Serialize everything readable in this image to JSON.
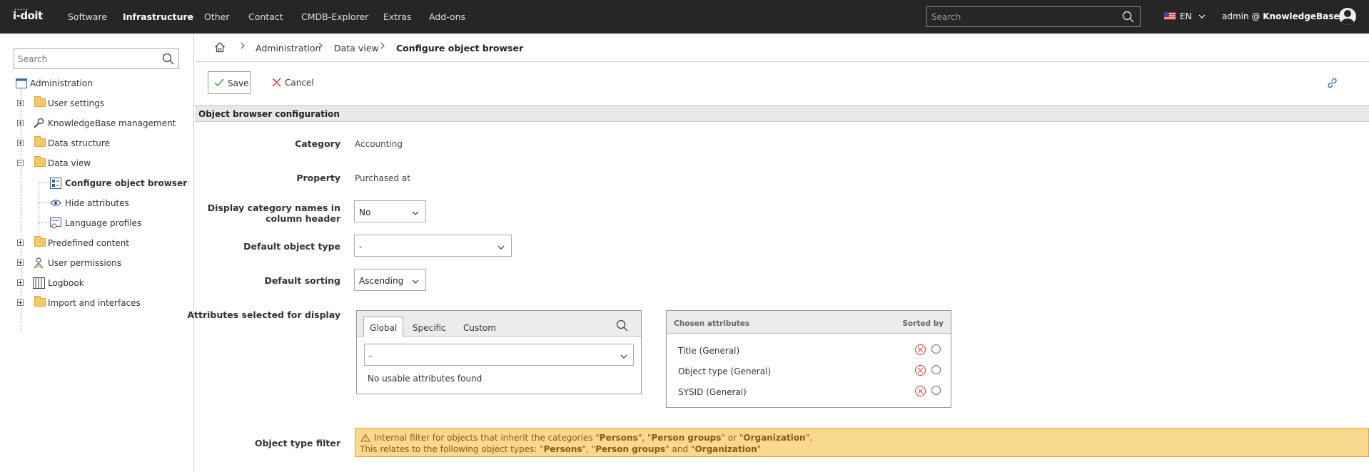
{
  "app": {
    "logo": "i-doit"
  },
  "topnav": {
    "items": [
      "Software",
      "Infrastructure",
      "Other",
      "Contact",
      "CMDB-Explorer",
      "Extras",
      "Add-ons"
    ],
    "active": "Infrastructure",
    "search_placeholder": "Search",
    "language": "EN",
    "user_prefix": "admin @ ",
    "user_tenant": "KnowledgeBase"
  },
  "sidebar": {
    "search_placeholder": "Search",
    "root": "Administration",
    "items": [
      {
        "label": "User settings",
        "icon": "folder-icon"
      },
      {
        "label": "KnowledgeBase management",
        "icon": "wrench-icon"
      },
      {
        "label": "Data structure",
        "icon": "folder-icon"
      },
      {
        "label": "Data view",
        "icon": "folder-icon",
        "expanded": true
      },
      {
        "label": "Configure object browser",
        "icon": "object-browser-icon",
        "selected": true
      },
      {
        "label": "Hide attributes",
        "icon": "eye-icon"
      },
      {
        "label": "Language profiles",
        "icon": "language-profile-icon"
      },
      {
        "label": "Predefined content",
        "icon": "folder-icon"
      },
      {
        "label": "User permissions",
        "icon": "user-permissions-icon"
      },
      {
        "label": "Logbook",
        "icon": "logbook-icon"
      },
      {
        "label": "Import and interfaces",
        "icon": "folder-icon"
      }
    ]
  },
  "breadcrumb": [
    "Administration",
    "Data view",
    "Configure object browser"
  ],
  "toolbar": {
    "save_label": "Save",
    "cancel_label": "Cancel"
  },
  "section": {
    "title": "Object browser configuration"
  },
  "form": {
    "category_label": "Category",
    "category_value": "Accounting",
    "property_label": "Property",
    "property_value": "Purchased at",
    "display_cat_label_1": "Display category names in",
    "display_cat_label_2": "column header",
    "display_cat_value": "No",
    "default_type_label": "Default object type",
    "default_type_value": "-",
    "default_sort_label": "Default sorting",
    "default_sort_value": "Ascending",
    "attributes_label": "Attributes selected for display",
    "object_type_filter_label": "Object type filter"
  },
  "attributes": {
    "tabs": [
      "Global",
      "Specific",
      "Custom"
    ],
    "active_tab": "Global",
    "select_value": "-",
    "empty_message": "No usable attributes found",
    "chosen_header": "Chosen attributes",
    "sorted_header": "Sorted by",
    "chosen": [
      "Title (General)",
      "Object type (General)",
      "SYSID (General)"
    ]
  },
  "warning": {
    "line1_a": "Internal filter for objects that inherit the categories \"",
    "line1_b": "Persons",
    "line1_c": "\", \"",
    "line1_d": "Person groups",
    "line1_e": "\" or \"",
    "line1_f": "Organization",
    "line1_g": "\".",
    "line2_a": "This relates to the following object types: \"",
    "line2_b": "Persons",
    "line2_c": "\", \"",
    "line2_d": "Person groups",
    "line2_e": "\" and \"",
    "line2_f": "Organization",
    "line2_g": "\""
  }
}
